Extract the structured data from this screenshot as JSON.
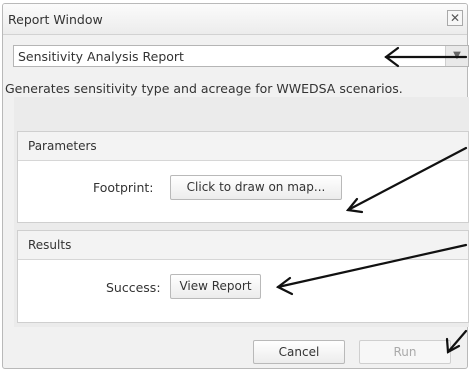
{
  "window": {
    "title": "Report Window",
    "close_glyph": "✕"
  },
  "report_select": {
    "value": "Sensitivity Analysis Report",
    "arrow_glyph": "▼"
  },
  "description": "Generates sensitivity type and acreage for WWEDSA scenarios.",
  "parameters": {
    "header": "Parameters",
    "footprint_label": "Footprint:",
    "footprint_button": "Click to draw on map..."
  },
  "results": {
    "header": "Results",
    "success_label": "Success:",
    "view_report_button": "View Report"
  },
  "footer": {
    "cancel_label": "Cancel",
    "run_label": "Run"
  }
}
